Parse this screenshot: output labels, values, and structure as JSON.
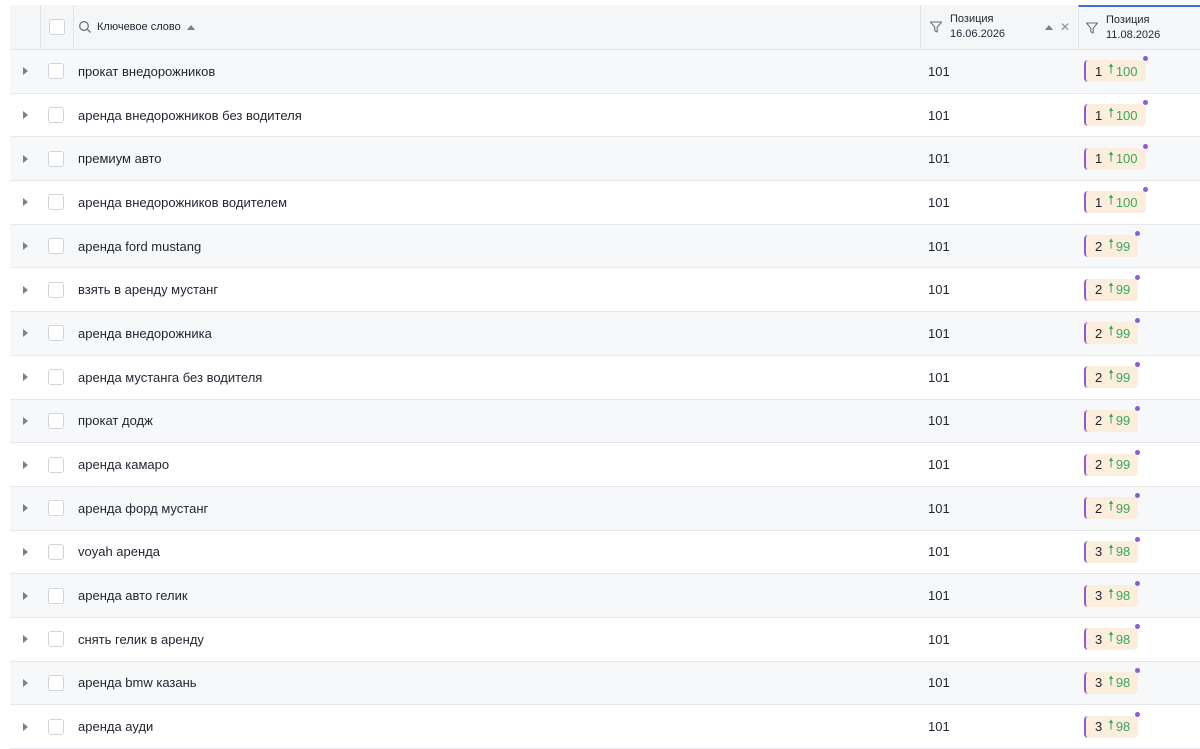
{
  "header": {
    "keyword_label": "Ключевое слово",
    "pos1_label": "Позиция",
    "pos1_date": "16.06.2026",
    "pos2_label": "Позиция",
    "pos2_date": "11.08.2026"
  },
  "rows": [
    {
      "keyword": "прокат внедорожников",
      "pos1": "101",
      "pos2": "1",
      "change": "100"
    },
    {
      "keyword": "аренда внедорожников без водителя",
      "pos1": "101",
      "pos2": "1",
      "change": "100"
    },
    {
      "keyword": "премиум авто",
      "pos1": "101",
      "pos2": "1",
      "change": "100"
    },
    {
      "keyword": "аренда внедорожников водителем",
      "pos1": "101",
      "pos2": "1",
      "change": "100"
    },
    {
      "keyword": "аренда ford mustang",
      "pos1": "101",
      "pos2": "2",
      "change": "99"
    },
    {
      "keyword": "взять в аренду мустанг",
      "pos1": "101",
      "pos2": "2",
      "change": "99"
    },
    {
      "keyword": "аренда внедорожника",
      "pos1": "101",
      "pos2": "2",
      "change": "99"
    },
    {
      "keyword": "аренда мустанга без водителя",
      "pos1": "101",
      "pos2": "2",
      "change": "99"
    },
    {
      "keyword": "прокат додж",
      "pos1": "101",
      "pos2": "2",
      "change": "99"
    },
    {
      "keyword": "аренда камаро",
      "pos1": "101",
      "pos2": "2",
      "change": "99"
    },
    {
      "keyword": "аренда форд мустанг",
      "pos1": "101",
      "pos2": "2",
      "change": "99"
    },
    {
      "keyword": "voyah аренда",
      "pos1": "101",
      "pos2": "3",
      "change": "98"
    },
    {
      "keyword": "аренда авто гелик",
      "pos1": "101",
      "pos2": "3",
      "change": "98"
    },
    {
      "keyword": "снять гелик в аренду",
      "pos1": "101",
      "pos2": "3",
      "change": "98"
    },
    {
      "keyword": "аренда bmw казань",
      "pos1": "101",
      "pos2": "3",
      "change": "98"
    },
    {
      "keyword": "аренда ауди",
      "pos1": "101",
      "pos2": "3",
      "change": "98"
    }
  ],
  "colors": {
    "accent": "#3b6fd9",
    "badge_bg": "#fbeedd",
    "badge_border": "#8a5cd8",
    "positive": "#3aa85a"
  }
}
